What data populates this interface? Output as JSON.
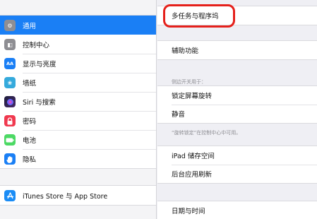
{
  "sidebar": {
    "items": [
      {
        "label": "通用",
        "icon": "gear-icon",
        "color": "#8e8e93",
        "glyph": "⚙",
        "selected": true
      },
      {
        "label": "控制中心",
        "icon": "control-center-icon",
        "color": "#8e8e93",
        "glyph": "◧"
      },
      {
        "label": "显示与亮度",
        "icon": "display-brightness-icon",
        "color": "#1a7ff5",
        "glyph": "AA"
      },
      {
        "label": "墙纸",
        "icon": "wallpaper-icon",
        "color": "#35aadc",
        "glyph": "❀"
      },
      {
        "label": "Siri 与搜索",
        "icon": "siri-icon",
        "color": "#2b2b55",
        "glyph": "◉"
      },
      {
        "label": "密码",
        "icon": "passcode-icon",
        "color": "#f0394f",
        "glyph": "▣"
      },
      {
        "label": "电池",
        "icon": "battery-icon",
        "color": "#4cd964",
        "glyph": "▬"
      },
      {
        "label": "隐私",
        "icon": "privacy-hand-icon",
        "color": "#1a7ff5",
        "glyph": "✋"
      }
    ],
    "store": {
      "label": "iTunes Store 与 App Store",
      "icon": "app-store-icon",
      "color": "#1a8cf5",
      "glyph": "A"
    }
  },
  "main": {
    "multitasking": "多任务与程序坞",
    "accessibility": "辅助功能",
    "side_switch_header": "侧边开关用于：",
    "lock_rotation": "锁定屏幕旋转",
    "mute": "静音",
    "side_switch_footer": "“旋转锁定”在控制中心中可用。",
    "ipad_storage": "iPad 储存空间",
    "background_refresh": "后台应用刷新",
    "date_time": "日期与时间"
  },
  "colors": {
    "accent": "#1a7ff5",
    "highlight": "#e5201b"
  }
}
